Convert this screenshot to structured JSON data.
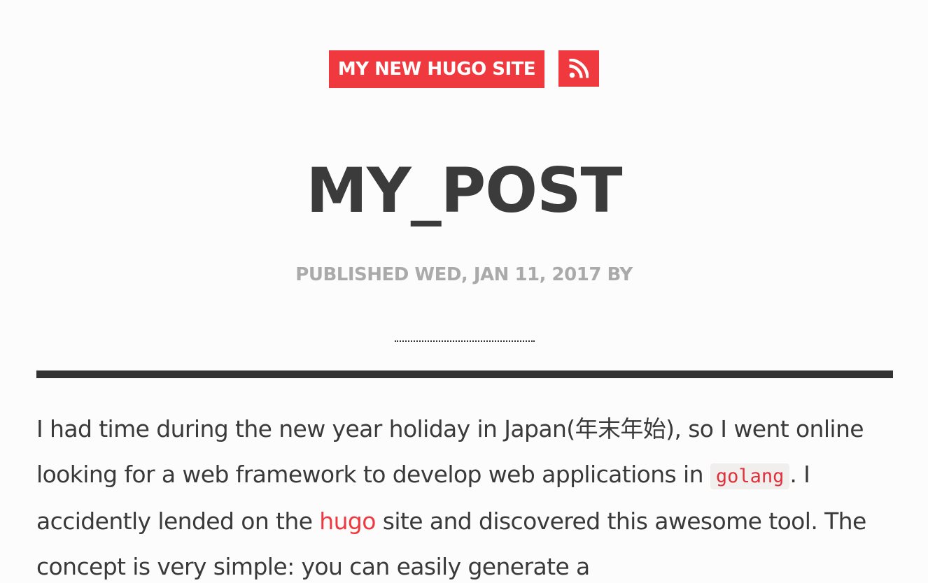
{
  "header": {
    "site_title": "MY NEW HUGO SITE",
    "rss_icon": "rss-icon"
  },
  "post": {
    "title": "MY_POST",
    "meta": "PUBLISHED WED, JAN 11, 2017 BY",
    "body": {
      "text_1": "I had time during the new year holiday in Japan(年末年始), so I went online looking for a web framework to develop web applications in ",
      "code_1": "golang",
      "text_2": ". I accidently lended on the ",
      "link_1": "hugo",
      "text_3": " site and discovered this awesome tool. The concept is very simple: you can easily generate a"
    }
  },
  "colors": {
    "accent": "#f0393e",
    "text": "#3a3a3a",
    "meta": "#aaaaaa",
    "rule": "#333333",
    "background": "#fdfcfc"
  }
}
